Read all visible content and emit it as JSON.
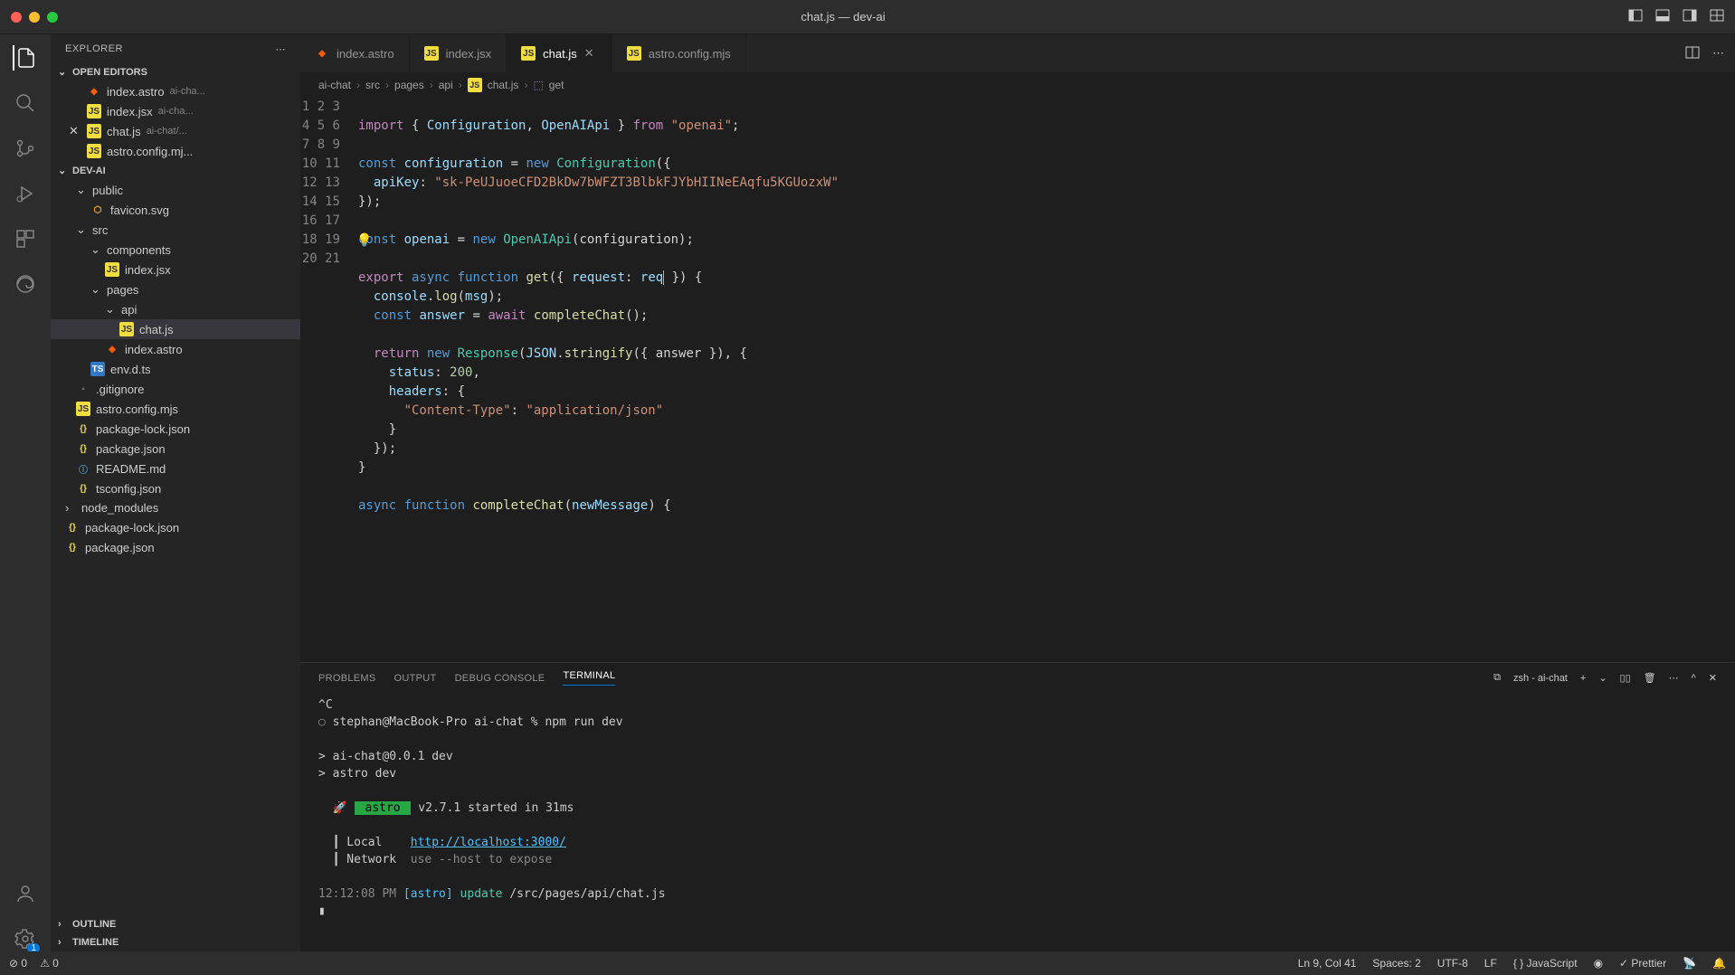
{
  "titlebar": {
    "title": "chat.js — dev-ai"
  },
  "explorer": {
    "title": "EXPLORER",
    "openEditors": "OPEN EDITORS",
    "project": "DEV-AI",
    "outline": "OUTLINE",
    "timeline": "TIMELINE",
    "editors": [
      {
        "name": "index.astro",
        "meta": "ai-cha..."
      },
      {
        "name": "index.jsx",
        "meta": "ai-cha..."
      },
      {
        "name": "chat.js",
        "meta": "ai-chat/..."
      },
      {
        "name": "astro.config.mj...",
        "meta": ""
      }
    ],
    "tree": {
      "public": "public",
      "favicon": "favicon.svg",
      "src": "src",
      "components": "components",
      "indexjsx": "index.jsx",
      "pages": "pages",
      "api": "api",
      "chatjs": "chat.js",
      "indexastro": "index.astro",
      "envdts": "env.d.ts",
      "gitignore": ".gitignore",
      "astroconfig": "astro.config.mjs",
      "pkglock": "package-lock.json",
      "pkg": "package.json",
      "readme": "README.md",
      "tsconfig": "tsconfig.json",
      "nodemodules": "node_modules",
      "pkglock2": "package-lock.json",
      "pkg2": "package.json"
    }
  },
  "tabs": [
    {
      "name": "index.astro"
    },
    {
      "name": "index.jsx"
    },
    {
      "name": "chat.js",
      "active": true
    },
    {
      "name": "astro.config.mjs"
    }
  ],
  "breadcrumb": [
    "ai-chat",
    "src",
    "pages",
    "api",
    "chat.js",
    "get"
  ],
  "code": {
    "l1": {
      "a": "import",
      "b": "{ ",
      "c": "Configuration",
      "d": ", ",
      "e": "OpenAIApi",
      "f": " } ",
      "g": "from",
      "h": " \"openai\"",
      "i": ";"
    },
    "l3": {
      "a": "const",
      "b": " configuration ",
      "c": "=",
      "d": " new ",
      "e": "Configuration",
      "f": "({"
    },
    "l4": {
      "a": "  apiKey",
      "b": ": ",
      "c": "\"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\""
    },
    "l5": "});",
    "l7": {
      "a": "const",
      "b": " openai ",
      "c": "=",
      "d": " new ",
      "e": "OpenAIApi",
      "f": "(configuration);"
    },
    "l9": {
      "a": "export",
      "b": " async ",
      "c": "function ",
      "d": "get",
      "e": "({",
      "f": " request",
      "g": ": ",
      "h": "req",
      "i": " }) {"
    },
    "l10": {
      "a": "  console",
      "b": ".",
      "c": "log",
      "d": "(",
      "e": "msg",
      "f": ");"
    },
    "l11": {
      "a": "  const",
      "b": " answer ",
      "c": "=",
      "d": " await ",
      "e": "completeChat",
      "f": "();"
    },
    "l13": {
      "a": "  return",
      "b": " new ",
      "c": "Response",
      "d": "(",
      "e": "JSON",
      "f": ".",
      "g": "stringify",
      "h": "({ answer }), {"
    },
    "l14": {
      "a": "    status",
      "b": ": ",
      "c": "200",
      "d": ","
    },
    "l15": {
      "a": "    headers",
      "b": ": {"
    },
    "l16": {
      "a": "      \"Content-Type\"",
      "b": ": ",
      "c": "\"application/json\""
    },
    "l17": "    }",
    "l18": "  });",
    "l19": "}",
    "l21": {
      "a": "async",
      "b": " function ",
      "c": "completeChat",
      "d": "(",
      "e": "newMessage",
      "f": ") {"
    }
  },
  "panel": {
    "tabs": {
      "problems": "PROBLEMS",
      "output": "OUTPUT",
      "debug": "DEBUG CONSOLE",
      "terminal": "TERMINAL"
    },
    "shell": "zsh - ai-chat"
  },
  "terminal": {
    "l1": "^C",
    "l2": {
      "a": "stephan@MacBook-Pro ai-chat % ",
      "b": "npm run dev"
    },
    "l3": "",
    "l4": "> ai-chat@0.0.1 dev",
    "l5": "> astro dev",
    "l6": "",
    "l7": {
      "rocket": "🚀 ",
      "astro": " astro ",
      "rest": " v2.7.1 started in 31ms"
    },
    "l8": "",
    "l9": {
      "a": "  ┃ Local    ",
      "b": "http://localhost:3000/"
    },
    "l10": {
      "a": "  ┃ Network  ",
      "b": "use --host to expose"
    },
    "l11": "",
    "l12": {
      "a": "12:12:08 PM ",
      "b": "[astro]",
      "c": " update ",
      "d": "/src/pages/api/chat.js"
    },
    "l13": "▮"
  },
  "statusbar": {
    "errors": "0",
    "warnings": "0",
    "pos": "Ln 9, Col 41",
    "spaces": "Spaces: 2",
    "encoding": "UTF-8",
    "eol": "LF",
    "lang": "JavaScript",
    "prettier": "Prettier"
  }
}
